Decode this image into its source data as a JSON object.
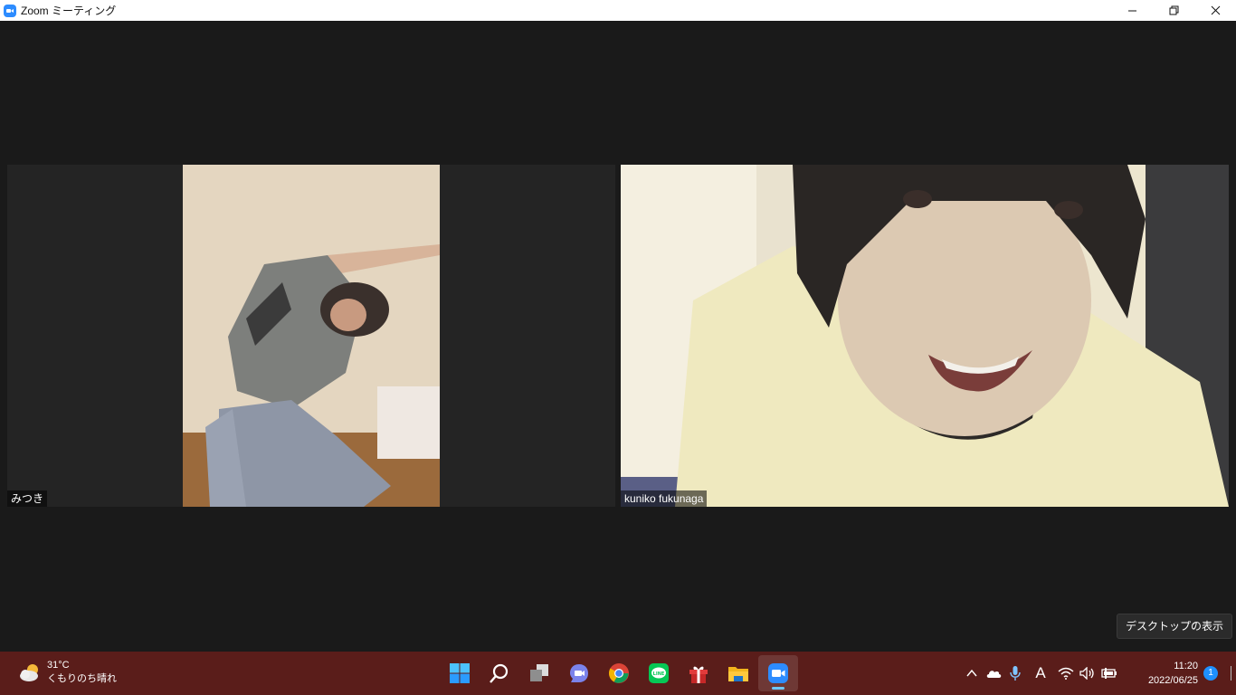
{
  "window": {
    "title": "Zoom ミーティング",
    "accent": "#2d8cff"
  },
  "participants": [
    {
      "name": "みつき"
    },
    {
      "name": "kuniko fukunaga"
    }
  ],
  "tooltip": {
    "text": "デスクトップの表示"
  },
  "taskbar": {
    "weather": {
      "temp": "31°C",
      "condition": "くもりのち晴れ"
    },
    "apps": [
      "start-icon",
      "search-icon",
      "task-view-icon",
      "teams-chat-icon",
      "chrome-icon",
      "line-icon",
      "gift-icon",
      "file-explorer-icon",
      "zoom-icon"
    ],
    "clock": {
      "time": "11:20",
      "date": "2022/06/25"
    },
    "notification_count": "1",
    "ime": "A",
    "background": "#5a1d1a"
  }
}
